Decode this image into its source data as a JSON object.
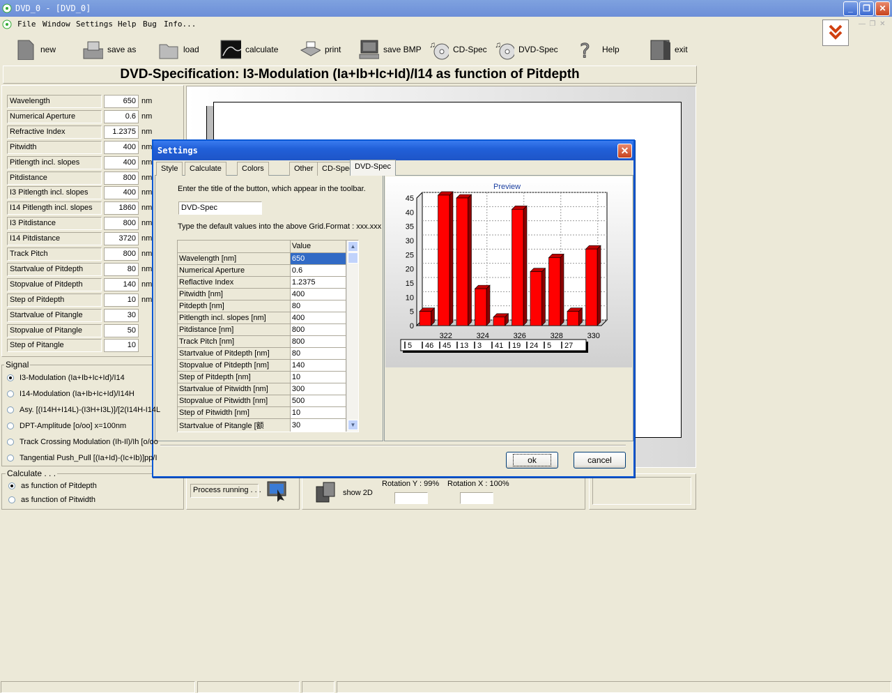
{
  "window": {
    "title": "DVD_0 - [DVD_0]",
    "btn_min": "_",
    "btn_max": "❐",
    "btn_close": "✕"
  },
  "menu": [
    "File",
    "Window",
    "Settings",
    "Help",
    "Bug",
    "Info..."
  ],
  "toolbar": [
    {
      "label": "new",
      "icon": "new-file-icon"
    },
    {
      "label": "save as",
      "icon": "save-as-icon"
    },
    {
      "label": "load",
      "icon": "load-folder-icon"
    },
    {
      "label": "calculate",
      "icon": "calculate-icon"
    },
    {
      "label": "print",
      "icon": "printer-icon"
    },
    {
      "label": "save BMP",
      "icon": "save-bmp-icon"
    },
    {
      "label": "CD-Spec",
      "icon": "cd-icon"
    },
    {
      "label": "DVD-Spec",
      "icon": "dvd-icon"
    },
    {
      "label": "Help",
      "icon": "help-icon"
    },
    {
      "label": "exit",
      "icon": "exit-door-icon"
    }
  ],
  "heading": "DVD-Specification: I3-Modulation (Ia+Ib+Ic+Id)/I14  as function of Pitdepth",
  "params": [
    {
      "label": "Wavelength",
      "value": "650",
      "unit": "nm"
    },
    {
      "label": "Numerical Aperture",
      "value": "0.6",
      "unit": "nm"
    },
    {
      "label": "Refractive Index",
      "value": "1.2375",
      "unit": "nm"
    },
    {
      "label": "Pitwidth",
      "value": "400",
      "unit": "nm"
    },
    {
      "label": "Pitlength incl. slopes",
      "value": "400",
      "unit": "nm"
    },
    {
      "label": "Pitdistance",
      "value": "800",
      "unit": "nm"
    },
    {
      "label": "I3 Pitlength incl. slopes",
      "value": "400",
      "unit": "nm"
    },
    {
      "label": "I14 Pitlength incl. slopes",
      "value": "1860",
      "unit": "nm"
    },
    {
      "label": "I3 Pitdistance",
      "value": "800",
      "unit": "nm"
    },
    {
      "label": "I14 Pitdistance",
      "value": "3720",
      "unit": "nm"
    },
    {
      "label": "Track Pitch",
      "value": "800",
      "unit": "nm"
    },
    {
      "label": "Startvalue of Pitdepth",
      "value": "80",
      "unit": "nm"
    },
    {
      "label": "Stopvalue of Pitdepth",
      "value": "140",
      "unit": "nm"
    },
    {
      "label": "Step of Pitdepth",
      "value": "10",
      "unit": "nm"
    },
    {
      "label": "Startvalue of Pitangle",
      "value": "30",
      "unit": ""
    },
    {
      "label": "Stopvalue of Pitangle",
      "value": "50",
      "unit": ""
    },
    {
      "label": "Step of Pitangle",
      "value": "10",
      "unit": ""
    }
  ],
  "signal": {
    "title": "Signal",
    "options": [
      {
        "label": "I3-Modulation (Ia+Ib+Ic+Id)/I14",
        "checked": true
      },
      {
        "label": "I14-Modulation (Ia+Ib+Ic+Id)/I14H",
        "checked": false
      },
      {
        "label": "Asy. [(I14H+I14L)-(I3H+I3L)]/[2(I14H-I14L",
        "checked": false
      },
      {
        "label": "DPT-Amplitude [o/oo] x=100nm",
        "checked": false
      },
      {
        "label": "Track Crossing Modulation (Ih-Il)/Ih [o/oo",
        "checked": false
      },
      {
        "label": "Tangential Push_Pull [(Ia+Id)-(Ic+Ib)]pp/I",
        "checked": false
      }
    ]
  },
  "calculate": {
    "title": "Calculate . . .",
    "options": [
      {
        "label": "as function of Pitdepth",
        "checked": true
      },
      {
        "label": "as function of Pitwidth",
        "checked": false
      }
    ]
  },
  "bottom": {
    "process": "Process running . . .",
    "show2d": "show 2D",
    "rotY": "Rotation Y : 99%",
    "rotX": "Rotation X : 100%"
  },
  "dialog": {
    "title": "Settings",
    "tabs": [
      "Style",
      "Calculate",
      "Colors",
      "Other",
      "CD-Spec",
      "DVD-Spec"
    ],
    "selected_tab": "DVD-Spec",
    "instr1": "Enter the title of the button, which appear in the toolbar.",
    "button_title": "DVD-Spec",
    "instr2": "Type the default values into the above Grid.Format : xxx.xxx",
    "grid_header": "Value",
    "grid": [
      {
        "label": "Wavelength [nm]",
        "value": "650"
      },
      {
        "label": "Numerical Aperture",
        "value": "0.6"
      },
      {
        "label": "Reflactive Index",
        "value": "1.2375"
      },
      {
        "label": "Pitwidth [nm]",
        "value": "400"
      },
      {
        "label": "Pitdepth [nm]",
        "value": "80"
      },
      {
        "label": "Pitlength incl. slopes [nm]",
        "value": "400"
      },
      {
        "label": "Pitdistance [nm]",
        "value": "800"
      },
      {
        "label": "Track Pitch [nm]",
        "value": "800"
      },
      {
        "label": "Startvalue of Pitdepth [nm]",
        "value": "80"
      },
      {
        "label": "Stopvalue of Pitdepth [nm]",
        "value": "140"
      },
      {
        "label": "Step of Pitdepth [nm]",
        "value": "10"
      },
      {
        "label": "Startvalue of Pitwidth [nm]",
        "value": "300"
      },
      {
        "label": "Stopvalue of Pitwidth [nm]",
        "value": "500"
      },
      {
        "label": "Step of Pitwidth [nm]",
        "value": "10"
      },
      {
        "label": "Startvalue of Pitangle [额",
        "value": "30"
      }
    ],
    "preview_label": "Preview",
    "ok": "ok",
    "cancel": "cancel"
  },
  "chart_data": {
    "type": "bar",
    "x": [
      321,
      322,
      323,
      324,
      325,
      326,
      327,
      328,
      329,
      330
    ],
    "values": [
      5,
      46,
      45,
      13,
      3,
      41,
      19,
      24,
      5,
      27
    ],
    "xticks": [
      "322",
      "324",
      "326",
      "328",
      "330"
    ],
    "yticks": [
      "0",
      "5",
      "10",
      "15",
      "20",
      "25",
      "30",
      "35",
      "40",
      "45"
    ],
    "ylim": [
      0,
      45
    ],
    "legend_values": [
      "5",
      "46",
      "45",
      "13",
      "3",
      "41",
      "19",
      "24",
      "5",
      "27"
    ],
    "bar_color": "#FF0000",
    "grid": true
  }
}
